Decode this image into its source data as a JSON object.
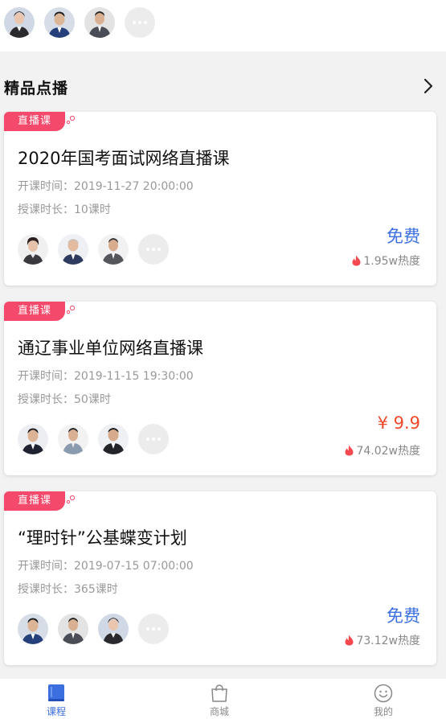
{
  "colors": {
    "accent_blue": "#3b6fe0",
    "badge_pink": "#f5496b",
    "price_red": "#f04a2b",
    "heat_red": "#f5494f"
  },
  "top_avatars": [
    {
      "icon": "avatar-woman"
    },
    {
      "icon": "avatar-man-blue-suit"
    },
    {
      "icon": "avatar-man-grey-suit"
    },
    {
      "icon": "more-dots-icon"
    }
  ],
  "section": {
    "title": "精品点播",
    "arrow_icon": "chevron-right-icon"
  },
  "courses": [
    {
      "badge": "直播课",
      "title": "2020年国考面试网络直播课",
      "start": "开课时间：2019-11-27 20:00:00",
      "duration": "授课时长：10课时",
      "price": "免费",
      "price_type": "free",
      "heat": "1.95w热度"
    },
    {
      "badge": "直播课",
      "title": "通辽事业单位网络直播课",
      "start": "开课时间：2019-11-15 19:30:00",
      "duration": "授课时长：50课时",
      "price": "¥ 9.9",
      "price_type": "paid",
      "heat": "74.02w热度"
    },
    {
      "badge": "直播课",
      "title": "“理时针”公基蝶变计划",
      "start": "开课时间：2019-07-15 07:00:00",
      "duration": "授课时长：365课时",
      "price": "免费",
      "price_type": "free",
      "heat": "73.12w热度"
    }
  ],
  "tabbar": {
    "items": [
      {
        "label": "课程",
        "icon": "book-icon",
        "active": true
      },
      {
        "label": "商城",
        "icon": "shopping-bag-icon",
        "active": false
      },
      {
        "label": "我的",
        "icon": "smiley-icon",
        "active": false
      }
    ]
  }
}
